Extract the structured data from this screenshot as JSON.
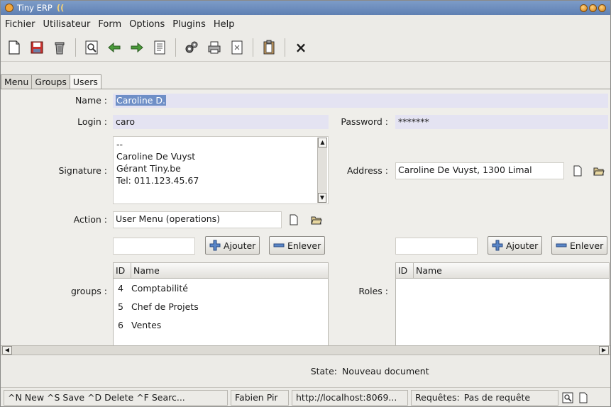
{
  "window": {
    "title": "Tiny ERP",
    "title_mark": "(("
  },
  "menu": {
    "items": [
      "Fichier",
      "Utilisateur",
      "Form",
      "Options",
      "Plugins",
      "Help"
    ]
  },
  "toolbar": {
    "close_symbol": "×"
  },
  "tabs": [
    "Menu",
    "Groups",
    "Users"
  ],
  "form": {
    "name_label": "Name :",
    "name_value": "Caroline D.",
    "login_label": "Login :",
    "login_value": "caro",
    "password_label": "Password :",
    "password_value": "*******",
    "signature_label": "Signature :",
    "signature_lines": [
      "--",
      "Caroline De Vuyst",
      "Gérant Tiny.be",
      "Tel: 011.123.45.67"
    ],
    "address_label": "Address :",
    "address_value": "Caroline De Vuyst, 1300 Limal",
    "action_label": "Action :",
    "action_value": "User Menu (operations)",
    "groups_label": "groups :",
    "roles_label": "Roles :",
    "add_label": "Ajouter",
    "remove_label": "Enlever"
  },
  "groups_table": {
    "headers": [
      "ID",
      "Name"
    ],
    "rows": [
      {
        "id": "4",
        "name": "Comptabilité"
      },
      {
        "id": "5",
        "name": "Chef de Projets"
      },
      {
        "id": "6",
        "name": "Ventes"
      }
    ]
  },
  "roles_table": {
    "headers": [
      "ID",
      "Name"
    ]
  },
  "state": {
    "label": "State:",
    "value": "Nouveau document"
  },
  "statusbar": {
    "shortcuts": "^N New  ^S Save  ^D Delete  ^F Searc...",
    "user": "Fabien Pir",
    "url": "http://localhost:8069...",
    "requests_label": "Requêtes:",
    "requests_value": "Pas de requête"
  },
  "colors": {
    "title_bar": "#5f80b3",
    "selection": "#6f8fc7",
    "field_bg": "#e4e3f2"
  }
}
